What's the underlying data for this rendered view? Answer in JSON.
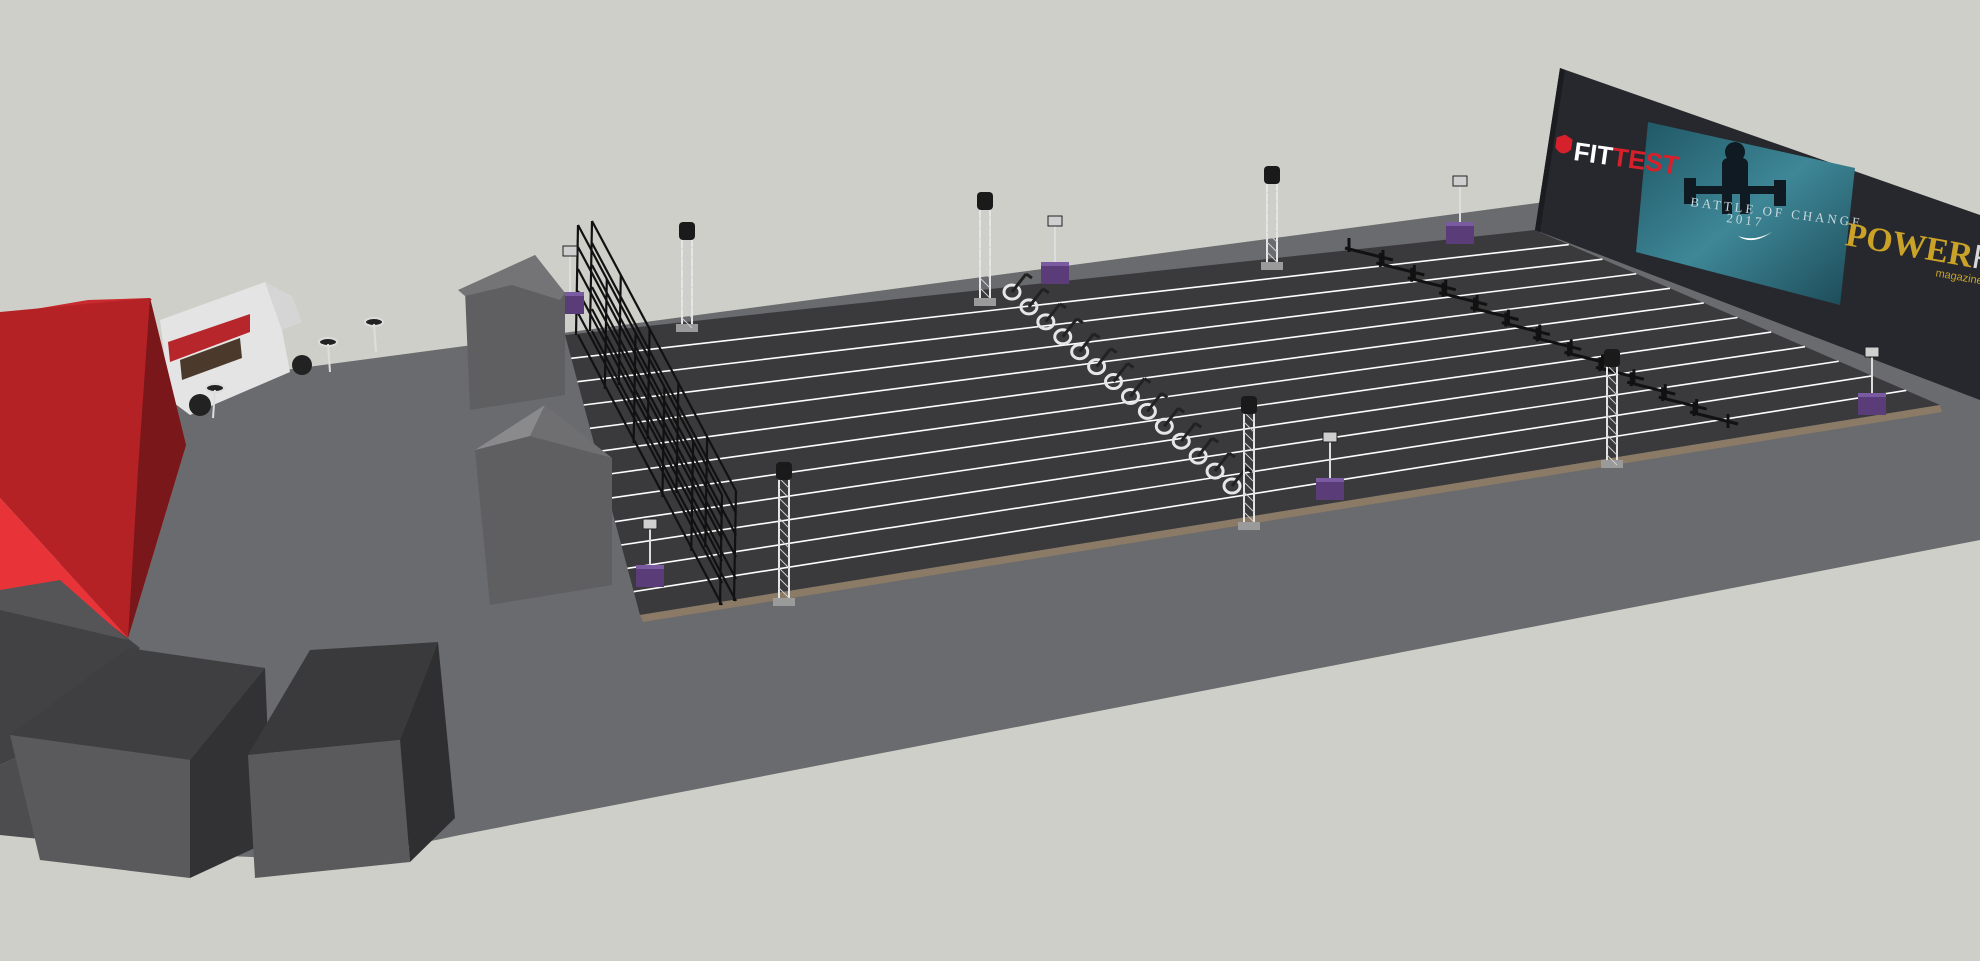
{
  "screen": {
    "sponsor_left": {
      "prefix": "FIT",
      "accent": "TEST",
      "brand_color": "#d6202b"
    },
    "sponsor_right": {
      "main": "POWER",
      "suffix": "FUL",
      "sub": "magazine",
      "brand_color": "#c9a227"
    },
    "banner": {
      "line1": "BATTLE OF CHANGE",
      "line2": "2017",
      "swoosh_icon": "nike-swoosh-icon"
    }
  },
  "colors": {
    "ground": "#cfcfc9",
    "concrete": "#6a6b6e",
    "track": "#3a3a3d",
    "lanes": "#ffffff",
    "screen": "#26282d",
    "banner": "#2f6f7e",
    "container": "#d3272c",
    "tents": "#5a5a5c",
    "speaker_cases": "#5a3d78"
  }
}
